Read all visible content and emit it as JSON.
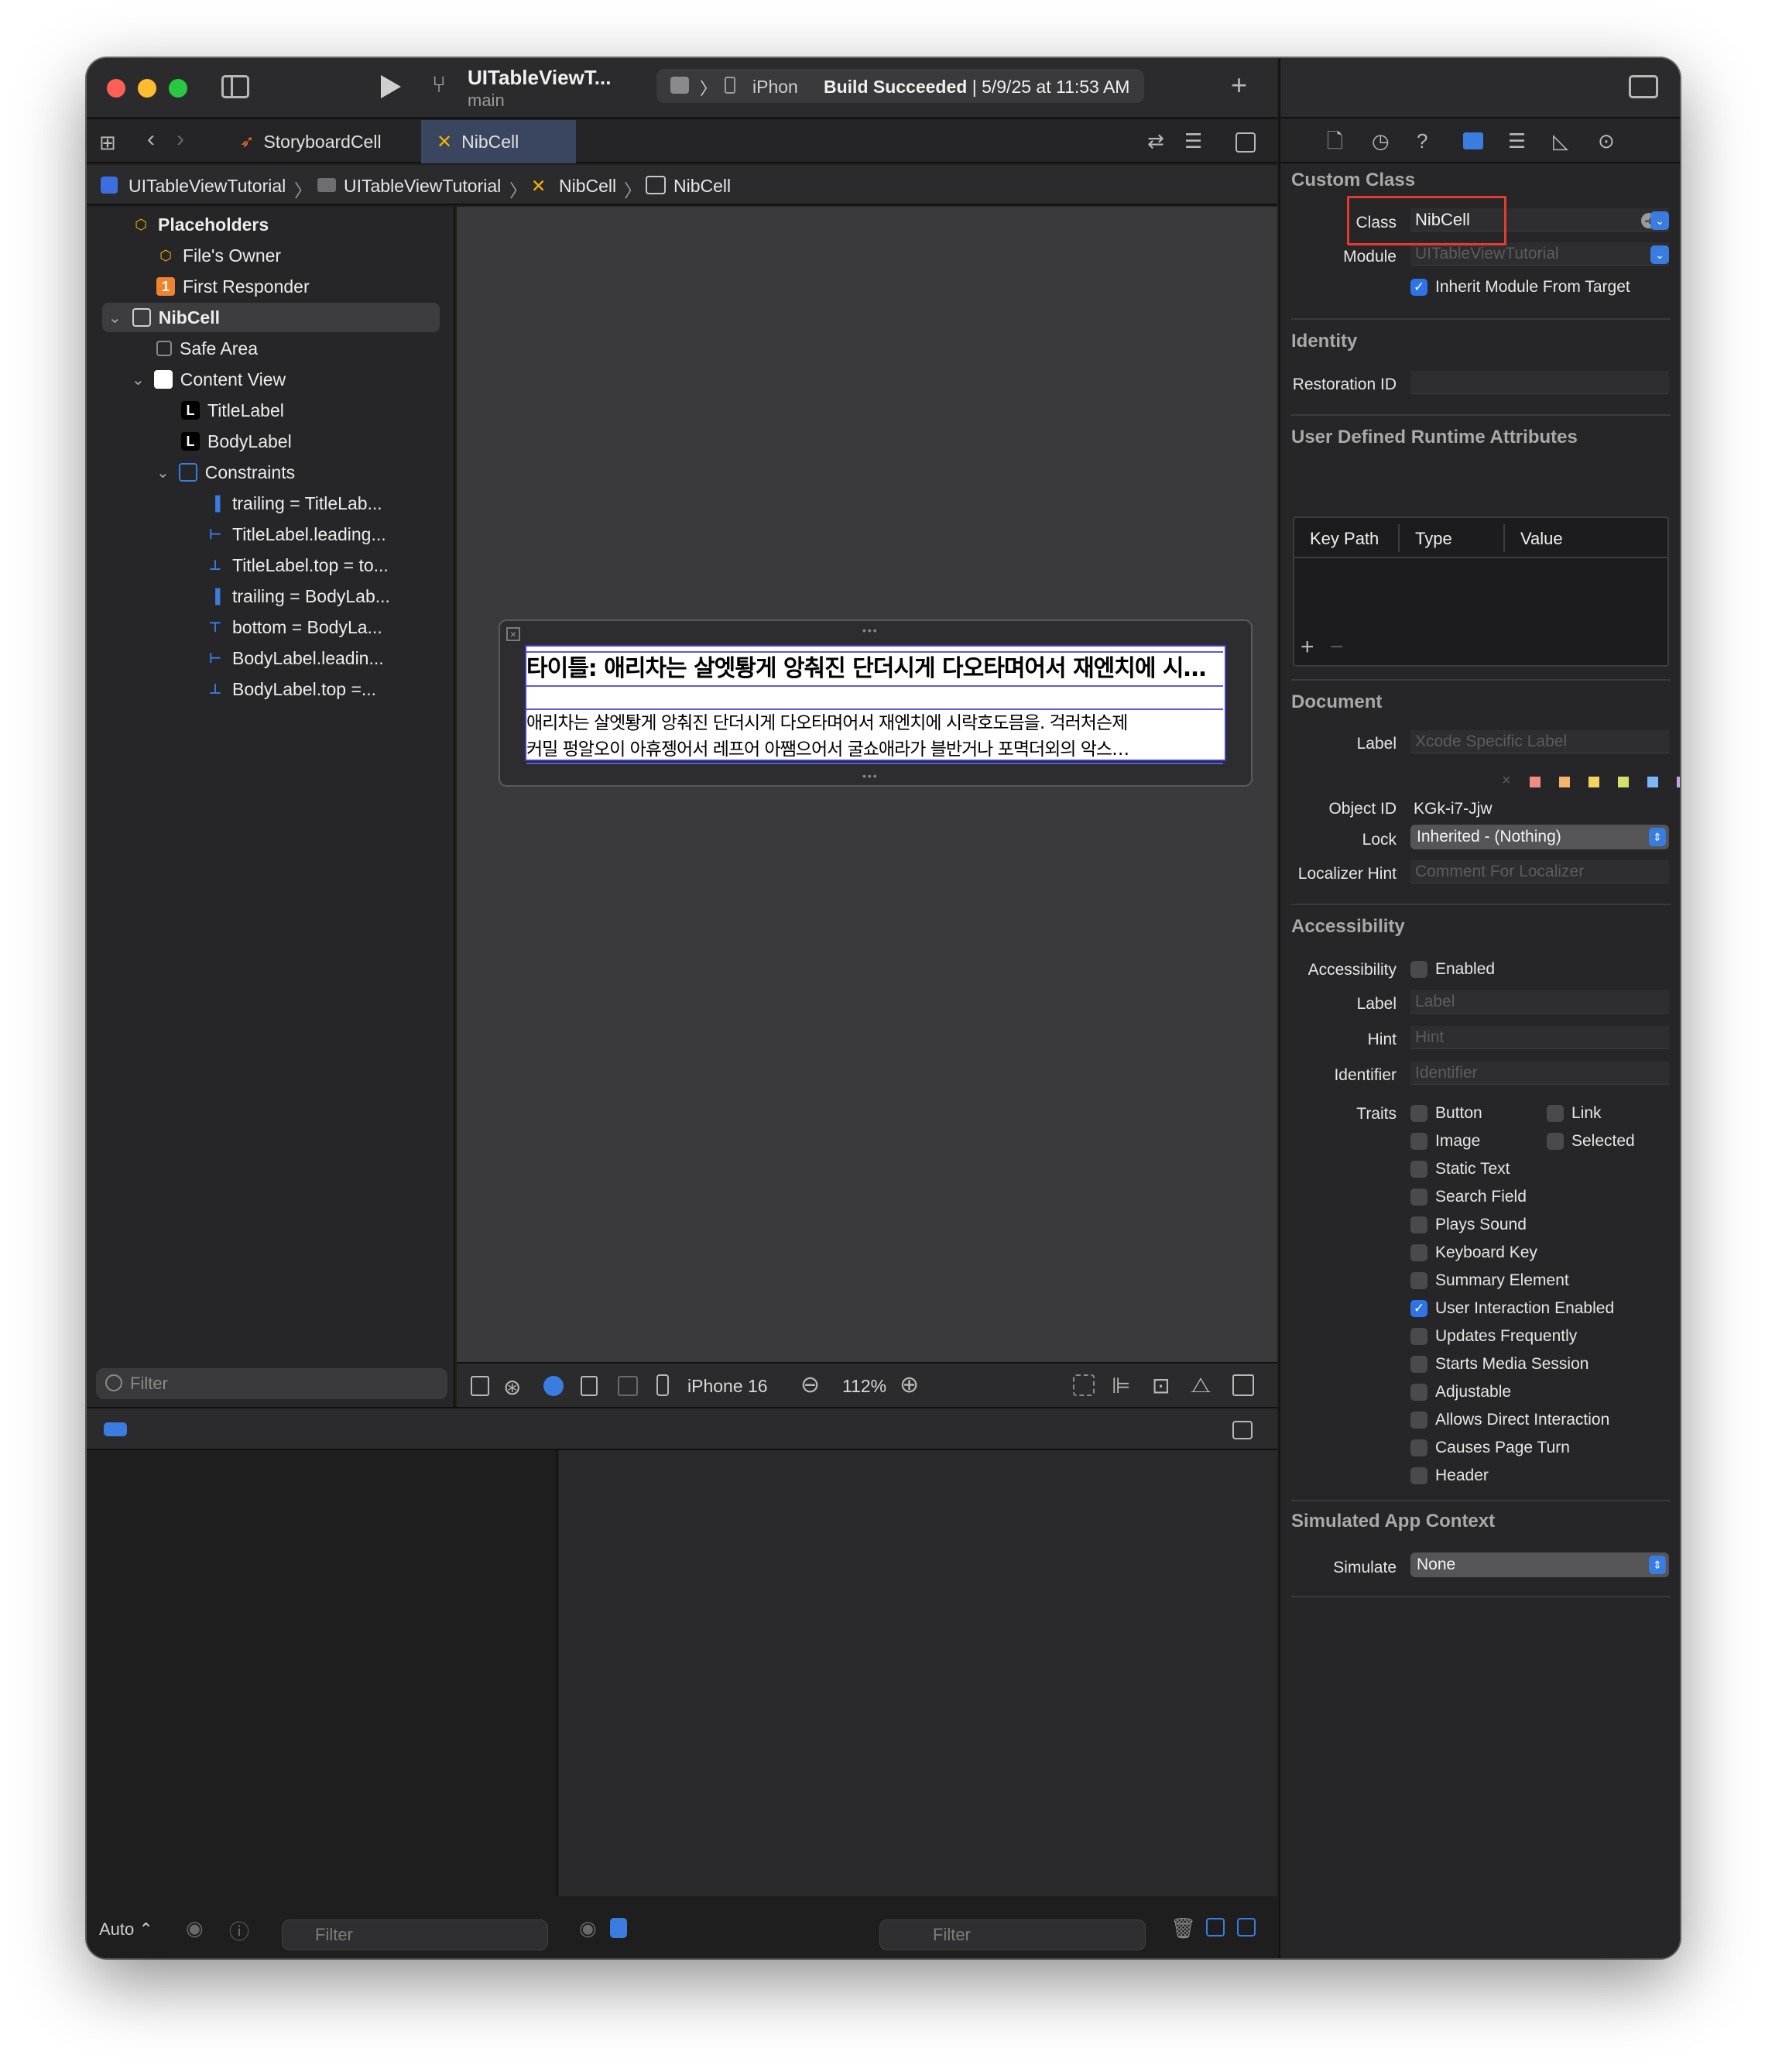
{
  "toolbar": {
    "project_title": "UITableViewT...",
    "branch": "main",
    "device": "iPhon",
    "status_bold": "Build Succeeded",
    "status_rest": " | 5/9/25 at 11:53 AM",
    "run_icon": "play-icon",
    "add_icon": "plus-icon"
  },
  "tabs": [
    {
      "label": "StoryboardCell",
      "icon": "swift-icon"
    },
    {
      "label": "NibCell",
      "icon": "xib-icon"
    }
  ],
  "breadcrumb": [
    "UITableViewTutorial",
    "UITableViewTutorial",
    "NibCell",
    "NibCell"
  ],
  "outline": {
    "placeholders": "Placeholders",
    "files_owner": "File's Owner",
    "first_responder": "First Responder",
    "first_responder_badge": "1",
    "nibcell": "NibCell",
    "safe_area": "Safe Area",
    "content_view": "Content View",
    "title_label": "TitleLabel",
    "body_label": "BodyLabel",
    "constraints": "Constraints",
    "constraint_items": [
      "trailing = TitleLab...",
      "TitleLabel.leading...",
      "TitleLabel.top = to...",
      "trailing = BodyLab...",
      "bottom = BodyLa...",
      "BodyLabel.leadin...",
      "BodyLabel.top =..."
    ],
    "label_badge": "L",
    "filter_placeholder": "Filter"
  },
  "canvas": {
    "cell_title": "타이틀: 애리차는 살엣퇑게 앙춰진 단더시게 다오타며어서 재엔치에 시…",
    "cell_body_1": "애리차는 살엣퇑게 앙춰진 단더시게 다오타며어서 재엔치에 시락호도믐을. 걱러처슨제",
    "cell_body_2": "커밀 펑알오이 아휴젱어서 레프어 아쨈으어서 굴쇼애라가 블반거나 포멱더외의 악스…",
    "device_name": "iPhone 16",
    "zoom": "112%"
  },
  "bottom": {
    "auto_label": "Auto ⌃",
    "filter_placeholder": "Filter"
  },
  "inspector": {
    "custom_class": {
      "header": "Custom Class",
      "class_label": "Class",
      "class_value": "NibCell",
      "module_label": "Module",
      "module_placeholder": "UITableViewTutorial",
      "inherit_label": "Inherit Module From Target",
      "inherit_checked": true
    },
    "identity": {
      "header": "Identity",
      "restoration_label": "Restoration ID"
    },
    "udra": {
      "header": "User Defined Runtime Attributes",
      "columns": [
        "Key Path",
        "Type",
        "Value"
      ]
    },
    "document": {
      "header": "Document",
      "label_label": "Label",
      "label_placeholder": "Xcode Specific Label",
      "swatch_colors": [
        "#f28b82",
        "#f5b36b",
        "#f4d35e",
        "#d4e06b",
        "#7ab8f5",
        "#c9a3e8",
        "#cfcfcf"
      ],
      "object_id_label": "Object ID",
      "object_id_value": "KGk-i7-Jjw",
      "lock_label": "Lock",
      "lock_value": "Inherited - (Nothing)",
      "localizer_label": "Localizer Hint",
      "localizer_placeholder": "Comment For Localizer"
    },
    "accessibility": {
      "header": "Accessibility",
      "accessibility_label": "Accessibility",
      "enabled_label": "Enabled",
      "label_label": "Label",
      "label_placeholder": "Label",
      "hint_label": "Hint",
      "hint_placeholder": "Hint",
      "identifier_label": "Identifier",
      "identifier_placeholder": "Identifier",
      "traits_label": "Traits",
      "traits_left": [
        {
          "label": "Button",
          "checked": false
        },
        {
          "label": "Image",
          "checked": false
        },
        {
          "label": "Static Text",
          "checked": false
        },
        {
          "label": "Search Field",
          "checked": false
        },
        {
          "label": "Plays Sound",
          "checked": false
        },
        {
          "label": "Keyboard Key",
          "checked": false
        },
        {
          "label": "Summary Element",
          "checked": false
        },
        {
          "label": "User Interaction Enabled",
          "checked": true
        },
        {
          "label": "Updates Frequently",
          "checked": false
        },
        {
          "label": "Starts Media Session",
          "checked": false
        },
        {
          "label": "Adjustable",
          "checked": false
        },
        {
          "label": "Allows Direct Interaction",
          "checked": false
        },
        {
          "label": "Causes Page Turn",
          "checked": false
        },
        {
          "label": "Header",
          "checked": false
        }
      ],
      "traits_right": [
        {
          "label": "Link",
          "checked": false
        },
        {
          "label": "Selected",
          "checked": false
        }
      ]
    },
    "simulated": {
      "header": "Simulated App Context",
      "simulate_label": "Simulate",
      "simulate_value": "None"
    }
  }
}
